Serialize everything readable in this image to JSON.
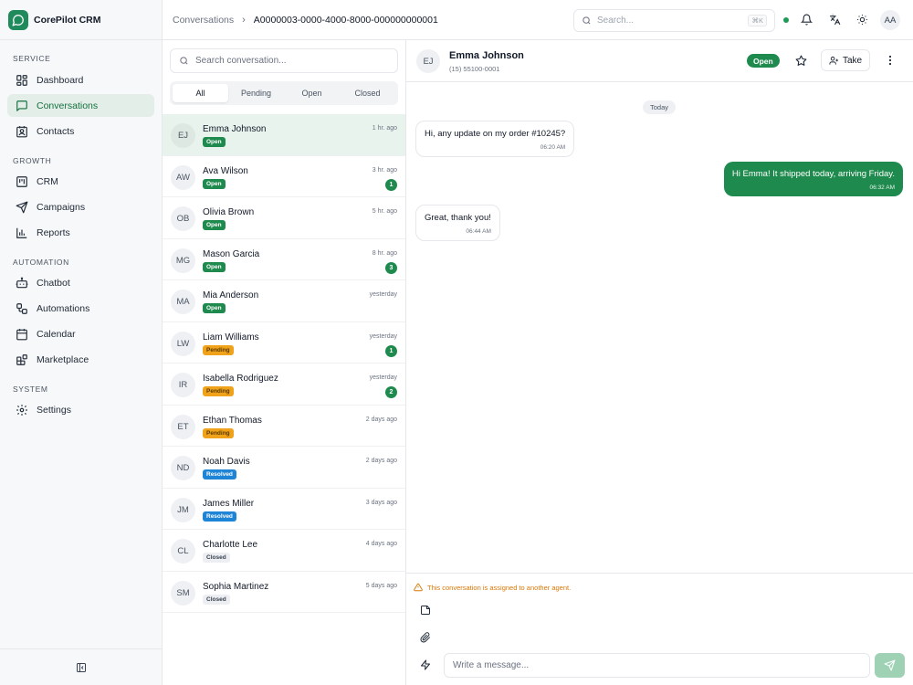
{
  "brand": {
    "name": "CorePilot CRM"
  },
  "sidebar": {
    "sections": [
      {
        "label": "SERVICE",
        "items": [
          {
            "label": "Dashboard",
            "icon": "dashboard-icon"
          },
          {
            "label": "Conversations",
            "icon": "chat-icon",
            "active": true
          },
          {
            "label": "Contacts",
            "icon": "contact-card-icon"
          }
        ]
      },
      {
        "label": "GROWTH",
        "items": [
          {
            "label": "CRM",
            "icon": "kanban-icon"
          },
          {
            "label": "Campaigns",
            "icon": "send-icon"
          },
          {
            "label": "Reports",
            "icon": "bar-chart-icon"
          }
        ]
      },
      {
        "label": "AUTOMATION",
        "items": [
          {
            "label": "Chatbot",
            "icon": "bot-icon"
          },
          {
            "label": "Automations",
            "icon": "workflow-icon"
          },
          {
            "label": "Calendar",
            "icon": "calendar-icon"
          },
          {
            "label": "Marketplace",
            "icon": "blocks-icon"
          }
        ]
      },
      {
        "label": "SYSTEM",
        "items": [
          {
            "label": "Settings",
            "icon": "gear-icon"
          }
        ]
      }
    ]
  },
  "topbar": {
    "breadcrumb": [
      "Conversations",
      "A0000003-0000-4000-8000-000000000001"
    ],
    "search_placeholder": "Search...",
    "search_shortcut": "⌘K",
    "user_initials": "AA"
  },
  "conversation_list": {
    "search_placeholder": "Search conversation...",
    "tabs": [
      "All",
      "Pending",
      "Open",
      "Closed"
    ],
    "active_tab": "All",
    "items": [
      {
        "initials": "EJ",
        "name": "Emma Johnson",
        "time": "1 hr. ago",
        "status": "Open",
        "unread": null,
        "active": true
      },
      {
        "initials": "AW",
        "name": "Ava Wilson",
        "time": "3 hr. ago",
        "status": "Open",
        "unread": "1"
      },
      {
        "initials": "OB",
        "name": "Olivia Brown",
        "time": "5 hr. ago",
        "status": "Open",
        "unread": null
      },
      {
        "initials": "MG",
        "name": "Mason Garcia",
        "time": "8 hr. ago",
        "status": "Open",
        "unread": "3"
      },
      {
        "initials": "MA",
        "name": "Mia Anderson",
        "time": "yesterday",
        "status": "Open",
        "unread": null
      },
      {
        "initials": "LW",
        "name": "Liam Williams",
        "time": "yesterday",
        "status": "Pending",
        "unread": "1"
      },
      {
        "initials": "IR",
        "name": "Isabella Rodriguez",
        "time": "yesterday",
        "status": "Pending",
        "unread": "2"
      },
      {
        "initials": "ET",
        "name": "Ethan Thomas",
        "time": "2 days ago",
        "status": "Pending",
        "unread": null
      },
      {
        "initials": "ND",
        "name": "Noah Davis",
        "time": "2 days ago",
        "status": "Resolved",
        "unread": null
      },
      {
        "initials": "JM",
        "name": "James Miller",
        "time": "3 days ago",
        "status": "Resolved",
        "unread": null
      },
      {
        "initials": "CL",
        "name": "Charlotte Lee",
        "time": "4 days ago",
        "status": "Closed",
        "unread": null
      },
      {
        "initials": "SM",
        "name": "Sophia Martinez",
        "time": "5 days ago",
        "status": "Closed",
        "unread": null
      }
    ]
  },
  "chat": {
    "contact": {
      "initials": "EJ",
      "name": "Emma Johnson",
      "phone": "(15) 55100-0001"
    },
    "status": "Open",
    "take_label": "Take",
    "date_divider": "Today",
    "messages": [
      {
        "direction": "in",
        "text": "Hi, any update on my order #10245?",
        "time": "06:20 AM"
      },
      {
        "direction": "out",
        "text": "Hi Emma! It shipped today, arriving Friday.",
        "time": "06:32 AM"
      },
      {
        "direction": "in",
        "text": "Great, thank you!",
        "time": "06:44 AM"
      }
    ],
    "warning": "This conversation is assigned to another agent.",
    "input_placeholder": "Write a message..."
  },
  "colors": {
    "accent": "#1f8a4e",
    "pending": "#f0a21a",
    "resolved": "#1e84d6",
    "warning": "#d97706"
  }
}
